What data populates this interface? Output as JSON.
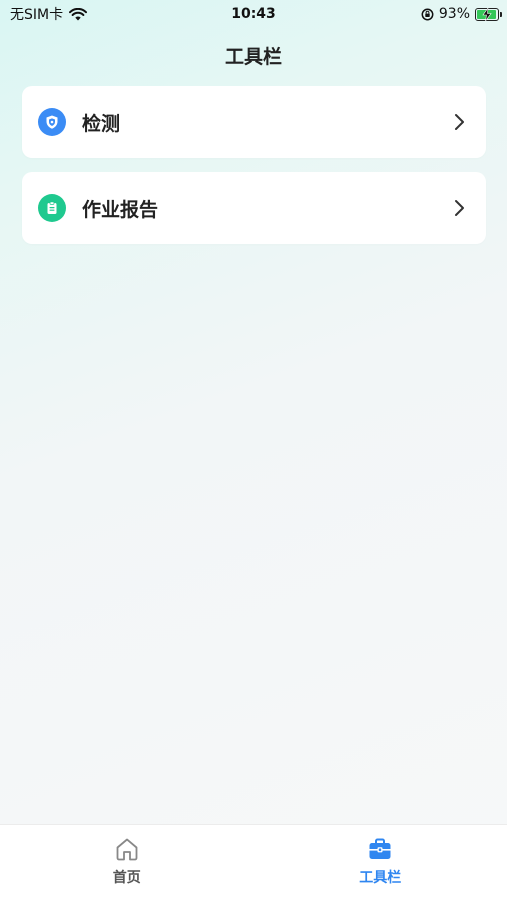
{
  "status_bar": {
    "carrier": "无SIM卡",
    "time": "10:43",
    "battery_percent": "93%",
    "battery_level": 0.93,
    "icons": [
      "wifi-icon",
      "screen-rotation-lock-icon",
      "battery-charging-icon"
    ]
  },
  "header": {
    "title": "工具栏"
  },
  "menu": {
    "items": [
      {
        "label": "检测",
        "icon": "shield-icon",
        "icon_color": "#3b8cf5"
      },
      {
        "label": "作业报告",
        "icon": "clipboard-icon",
        "icon_color": "#1fc98f"
      }
    ]
  },
  "tab_bar": {
    "active_color": "#2f86f0",
    "tabs": [
      {
        "label": "首页",
        "icon": "home-icon",
        "active": false
      },
      {
        "label": "工具栏",
        "icon": "toolbox-icon",
        "active": true
      }
    ]
  }
}
